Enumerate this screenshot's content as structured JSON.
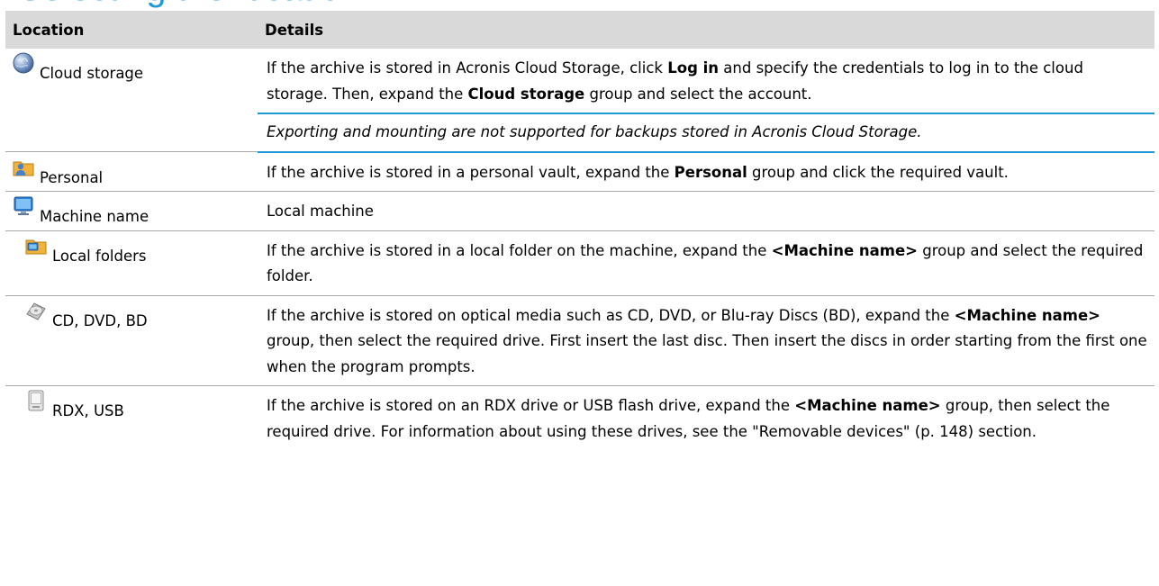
{
  "heading": "Selecting the location",
  "table": {
    "headers": {
      "location": "Location",
      "details": "Details"
    },
    "rows": {
      "cloud": {
        "label": "Cloud storage",
        "icon": "globe-icon",
        "details": {
          "a": "If the archive is stored in Acronis Cloud Storage, click ",
          "b": "Log in",
          "c": " and specify the credentials to log in to the cloud storage. Then, expand the ",
          "d": "Cloud storage",
          "e": " group and select the account."
        },
        "note": "Exporting and mounting are not supported for backups stored in Acronis Cloud Storage."
      },
      "personal": {
        "label": "Personal",
        "icon": "personal-vault-icon",
        "details": {
          "a": "If the archive is stored in a personal vault, expand the ",
          "b": "Personal",
          "c": " group and click the required vault."
        }
      },
      "machine": {
        "label": "Machine name",
        "icon": "computer-icon",
        "details": "Local machine"
      },
      "local_folders": {
        "label": "Local folders",
        "icon": "folder-icon",
        "details": {
          "a": "If the archive is stored in a local folder on the machine, expand the ",
          "b": "<Machine name>",
          "c": " group and select the required folder."
        }
      },
      "optical": {
        "label": "CD, DVD, BD",
        "icon": "optical-disc-icon",
        "details": {
          "a": "If the archive is stored on optical media such as CD, DVD, or Blu-ray Discs (BD), expand the ",
          "b": "<Machine name>",
          "c": " group, then select the required drive. First insert the last disc. Then insert the discs in order starting from the first one when the program prompts."
        }
      },
      "rdx": {
        "label": "RDX, USB",
        "icon": "removable-drive-icon",
        "details": {
          "a": "If the archive is stored on an RDX drive or USB flash drive, expand the ",
          "b": "<Machine name>",
          "c": " group, then select the required drive. For information about using these drives, see the \"Removable devices\" (p. 148) section."
        }
      }
    }
  },
  "colors": {
    "accent": "#1f9ad6",
    "header_bg": "#d9d9d9",
    "divider": "#a8a8a8"
  }
}
